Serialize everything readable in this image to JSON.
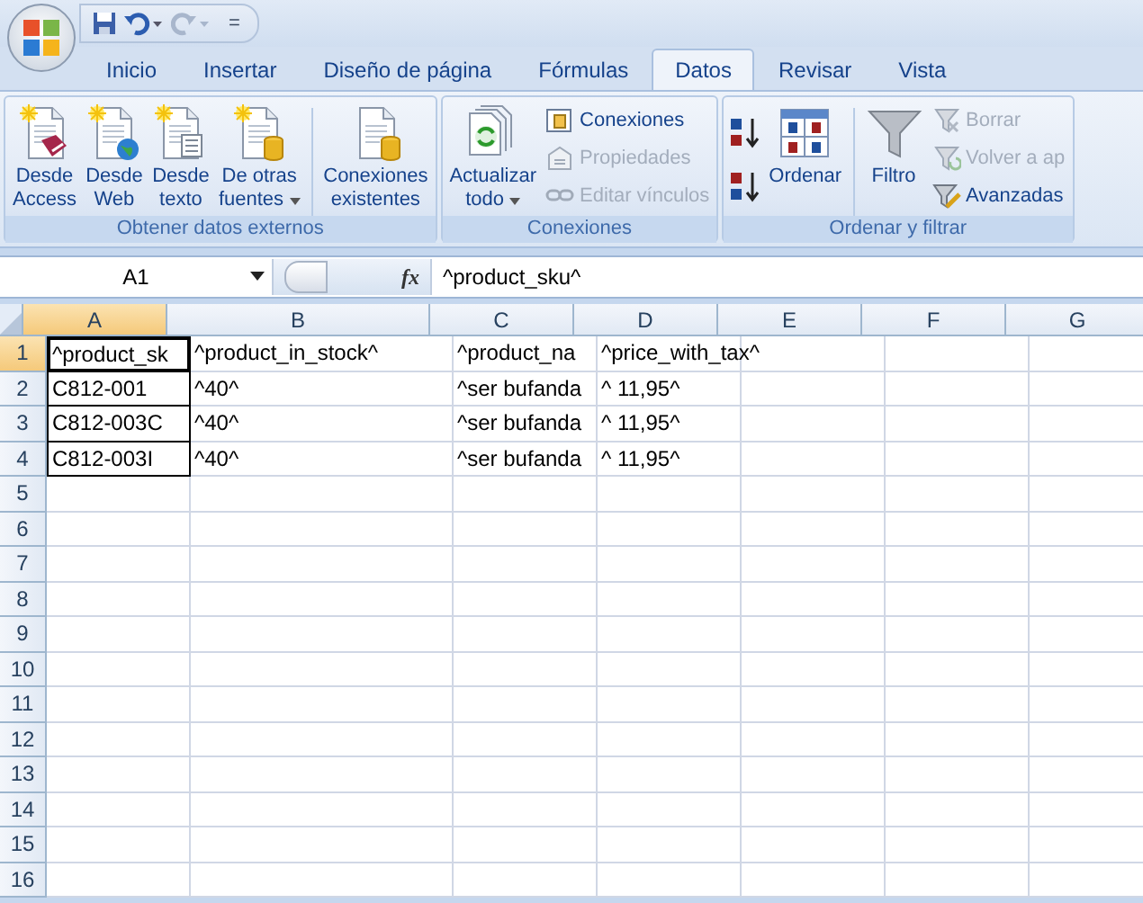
{
  "quick_access": {
    "customize": "="
  },
  "tabs": [
    {
      "label": "Inicio",
      "selected": false
    },
    {
      "label": "Insertar",
      "selected": false
    },
    {
      "label": "Diseño de página",
      "selected": false
    },
    {
      "label": "Fórmulas",
      "selected": false
    },
    {
      "label": "Datos",
      "selected": true
    },
    {
      "label": "Revisar",
      "selected": false
    },
    {
      "label": "Vista",
      "selected": false
    }
  ],
  "ribbon": {
    "groups": [
      {
        "label": "Obtener datos externos",
        "items": [
          {
            "kind": "big",
            "lines": [
              "Desde",
              "Access"
            ],
            "dropdown": false
          },
          {
            "kind": "big",
            "lines": [
              "Desde",
              "Web"
            ],
            "dropdown": false
          },
          {
            "kind": "big",
            "lines": [
              "Desde",
              "texto"
            ],
            "dropdown": false
          },
          {
            "kind": "big",
            "lines": [
              "De otras",
              "fuentes"
            ],
            "dropdown": true
          },
          {
            "kind": "separator"
          },
          {
            "kind": "big",
            "lines": [
              "Conexiones",
              "existentes"
            ],
            "dropdown": false
          }
        ]
      },
      {
        "label": "Conexiones",
        "items": [
          {
            "kind": "big",
            "lines": [
              "Actualizar",
              "todo"
            ],
            "dropdown": true
          },
          {
            "kind": "stack",
            "children": [
              {
                "label": "Conexiones",
                "disabled": false
              },
              {
                "label": "Propiedades",
                "disabled": true
              },
              {
                "label": "Editar vínculos",
                "disabled": true
              }
            ]
          }
        ]
      },
      {
        "label": "Ordenar y filtrar",
        "items": [
          {
            "kind": "sortpair"
          },
          {
            "kind": "big",
            "lines": [
              "Ordenar"
            ],
            "dropdown": false
          },
          {
            "kind": "separator"
          },
          {
            "kind": "big",
            "lines": [
              "Filtro"
            ],
            "dropdown": false
          },
          {
            "kind": "stack",
            "children": [
              {
                "label": "Borrar",
                "disabled": true
              },
              {
                "label": "Volver a ap",
                "disabled": true
              },
              {
                "label": "Avanzadas",
                "disabled": false
              }
            ]
          }
        ]
      }
    ]
  },
  "formula_bar": {
    "name_box": "A1",
    "function_label": "fx",
    "formula": "^product_sku^"
  },
  "sheet": {
    "columns": [
      {
        "label": "A",
        "selected": true
      },
      {
        "label": "B",
        "selected": false
      },
      {
        "label": "C",
        "selected": false
      },
      {
        "label": "D",
        "selected": false
      },
      {
        "label": "E",
        "selected": false
      },
      {
        "label": "F",
        "selected": false
      },
      {
        "label": "G",
        "selected": false
      }
    ],
    "rows": [
      {
        "label": "1",
        "selected": true,
        "cells": [
          {
            "text": "^product_sk",
            "selected": true,
            "boxed": true
          },
          {
            "text": "^product_in_stock^",
            "selected": false,
            "boxed": false
          },
          {
            "text": "^product_na",
            "selected": false,
            "boxed": false
          },
          {
            "text": "^price_with_tax^",
            "selected": false,
            "boxed": false
          }
        ]
      },
      {
        "label": "2",
        "selected": false,
        "cells": [
          {
            "text": "C812-001",
            "selected": false,
            "boxed": true
          },
          {
            "text": "^40^",
            "selected": false,
            "boxed": false
          },
          {
            "text": "^ser bufanda",
            "selected": false,
            "boxed": false
          },
          {
            "text": "^ 11,95^",
            "selected": false,
            "boxed": false
          }
        ]
      },
      {
        "label": "3",
        "selected": false,
        "cells": [
          {
            "text": "C812-003C",
            "selected": false,
            "boxed": true
          },
          {
            "text": "^40^",
            "selected": false,
            "boxed": false
          },
          {
            "text": "^ser bufanda",
            "selected": false,
            "boxed": false
          },
          {
            "text": "^ 11,95^",
            "selected": false,
            "boxed": false
          }
        ]
      },
      {
        "label": "4",
        "selected": false,
        "cells": [
          {
            "text": "C812-003I",
            "selected": false,
            "boxed": true
          },
          {
            "text": "^40^",
            "selected": false,
            "boxed": false
          },
          {
            "text": "^ser bufanda",
            "selected": false,
            "boxed": false
          },
          {
            "text": "^ 11,95^",
            "selected": false,
            "boxed": false
          }
        ]
      },
      {
        "label": "5",
        "selected": false,
        "cells": []
      },
      {
        "label": "6",
        "selected": false,
        "cells": []
      },
      {
        "label": "7",
        "selected": false,
        "cells": []
      },
      {
        "label": "8",
        "selected": false,
        "cells": []
      },
      {
        "label": "9",
        "selected": false,
        "cells": []
      },
      {
        "label": "10",
        "selected": false,
        "cells": []
      },
      {
        "label": "11",
        "selected": false,
        "cells": []
      },
      {
        "label": "12",
        "selected": false,
        "cells": []
      },
      {
        "label": "13",
        "selected": false,
        "cells": []
      },
      {
        "label": "14",
        "selected": false,
        "cells": []
      },
      {
        "label": "15",
        "selected": false,
        "cells": []
      },
      {
        "label": "16",
        "selected": false,
        "cells": []
      }
    ]
  }
}
